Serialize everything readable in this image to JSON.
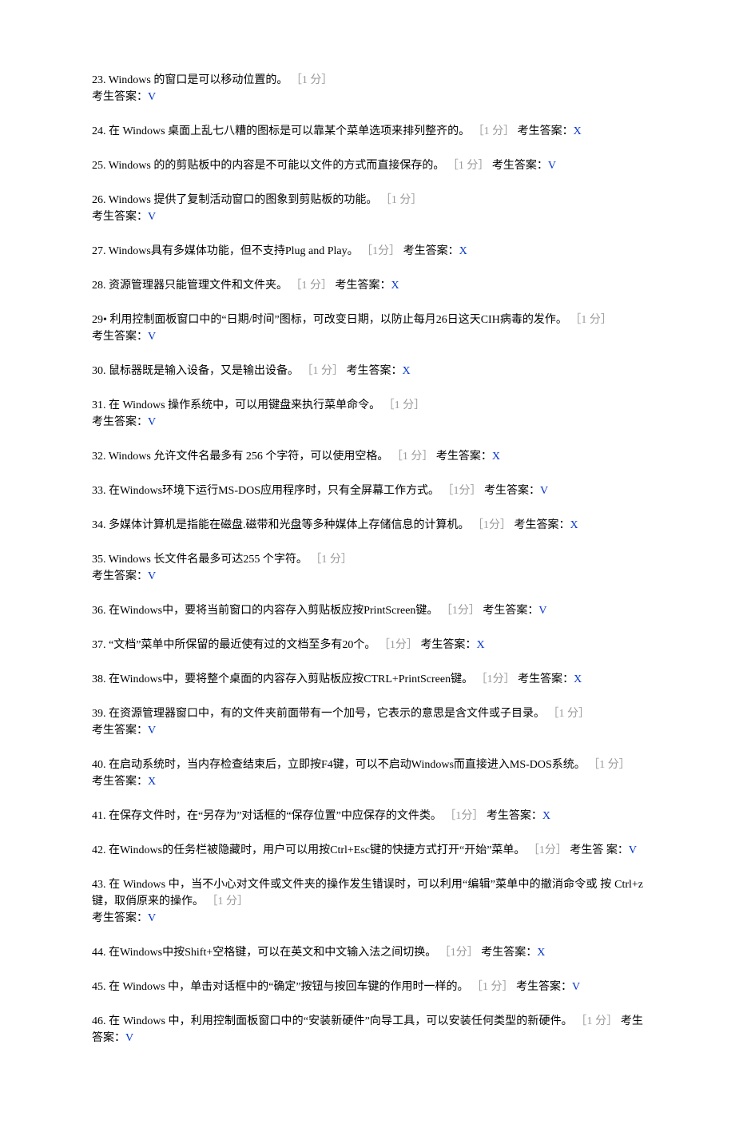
{
  "labels": {
    "answer_prefix": "考生答案：",
    "points_1": "［1 分］",
    "points_1_narrow": "［1分］",
    "points_split": "［1 分］"
  },
  "questions": [
    {
      "num": "23.",
      "text": "Windows 的窗口是可以移动位置的。",
      "points": "［1 分］",
      "answer": "V",
      "inline": false
    },
    {
      "num": "24.",
      "text": "在 Windows 桌面上乱七八糟的图标是可以靠某个菜单选项来排列整齐的。",
      "points": "［1 分］",
      "answer": "X",
      "inline": true
    },
    {
      "num": "25.",
      "text": "Windows 的的剪贴板中的内容是不可能以文件的方式而直接保存的。",
      "points": "［1 分］",
      "answer": "V",
      "inline": true
    },
    {
      "num": "26.",
      "text": "Windows 提供了复制活动窗口的图象到剪贴板的功能。",
      "points": "［1 分］",
      "answer": "V",
      "inline": false
    },
    {
      "num": "27.",
      "text": "Windows具有多媒体功能，但不支持Plug and Play。",
      "points": "［1分］",
      "answer": "X",
      "inline": true
    },
    {
      "num": "28.",
      "text": "资源管理器只能管理文件和文件夹。",
      "points": "［1 分］",
      "answer": "X",
      "inline": true
    },
    {
      "num": "29•",
      "text": "利用控制面板窗口中的“日期/时间”图标，可改变日期，以防止每月26日这天CIH病毒的发作。",
      "points": "［1 分］",
      "answer": "V",
      "inline": false
    },
    {
      "num": "30.",
      "text": "鼠标器既是输入设备，又是输出设备。",
      "points": "［1 分］",
      "answer": "X",
      "inline": true
    },
    {
      "num": "31.",
      "text": "在 Windows 操作系统中，可以用键盘来执行菜单命令。",
      "points": "［1 分］",
      "answer": "V",
      "inline": false
    },
    {
      "num": "32.",
      "text": "Windows 允许文件名最多有 256 个字符，可以使用空格。",
      "points": "［1 分］",
      "answer": "X",
      "inline": true
    },
    {
      "num": "33.",
      "text": "在Windows环境下运行MS-DOS应用程序时，只有全屏幕工作方式。",
      "points": "［1分］",
      "answer": "V",
      "inline": true
    },
    {
      "num": "34.",
      "text": "多媒体计算机是指能在磁盘.磁带和光盘等多种媒体上存储信息的计算机。",
      "points": "［1分］",
      "answer": "X",
      "inline": true
    },
    {
      "num": "35.",
      "text": "Windows 长文件名最多可达255 个字符。",
      "points": "［1 分］",
      "answer": "V",
      "inline": false
    },
    {
      "num": "36.",
      "text": "在Windows中，要将当前窗口的内容存入剪贴板应按PrintScreen键。",
      "points": "［1分］",
      "answer": "V",
      "inline": true
    },
    {
      "num": "37.",
      "text": "“文档”菜单中所保留的最近使有过的文档至多有20个。",
      "points": " ［1分］ ",
      "answer": "X",
      "inline": true
    },
    {
      "num": "38.",
      "text": "在Windows中，要将整个桌面的内容存入剪贴板应按CTRL+PrintScreen键。",
      "points": "［1分］",
      "answer": "X",
      "inline": true
    },
    {
      "num": "39.",
      "text": "在资源管理器窗口中，有的文件夹前面带有一个加号，它表示的意思是含文件或子目录。",
      "points": "［1 分］",
      "answer": "V",
      "inline": false
    },
    {
      "num": "40.",
      "text": "在启动系统时，当内存检查结束后，立即按F4键，可以不启动Windows而直接进入MS-DOS系统。",
      "points": "［1 分］",
      "answer": "X",
      "inline": false
    },
    {
      "num": "41.",
      "text": "在保存文件时，在“另存为”对话框的“保存位置”中应保存的文件类。",
      "points": " ［1分］",
      "answer": "X",
      "inline": true
    },
    {
      "num": "42.",
      "text": "在Windows的任务栏被隐藏时，用户可以用按Ctrl+Esc键的快捷方式打开“开始”菜单。",
      "points": "［1分］",
      "answer": "V",
      "inline": true,
      "answer_label": "考生答 案："
    },
    {
      "num": "43.",
      "text": "在 Windows 中，当不小心对文件或文件夹的操作发生错误时，可以利用“编辑”菜单中的撤消命令或 按 Ctrl+z 键，取俏原来的操作。",
      "points": "［1 分］",
      "answer": "V",
      "inline": false
    },
    {
      "num": "44.",
      "text": "在Windows中按Shift+空格键，可以在英文和中文输入法之间切换。",
      "points": "［1分］",
      "answer": "X",
      "inline": true
    },
    {
      "num": "45.",
      "text": "在 Windows 中，单击对话框中的“确定”按钮与按回车键的作用时一样的。",
      "points": "［1 分］",
      "answer": "V",
      "inline": true
    },
    {
      "num": "46.",
      "text": "在 Windows 中，利用控制面板窗口中的“安装新硬件”向导工具，可以安装任何类型的新硬件。",
      "points": "［1 分］",
      "answer": "V",
      "inline": true
    }
  ]
}
